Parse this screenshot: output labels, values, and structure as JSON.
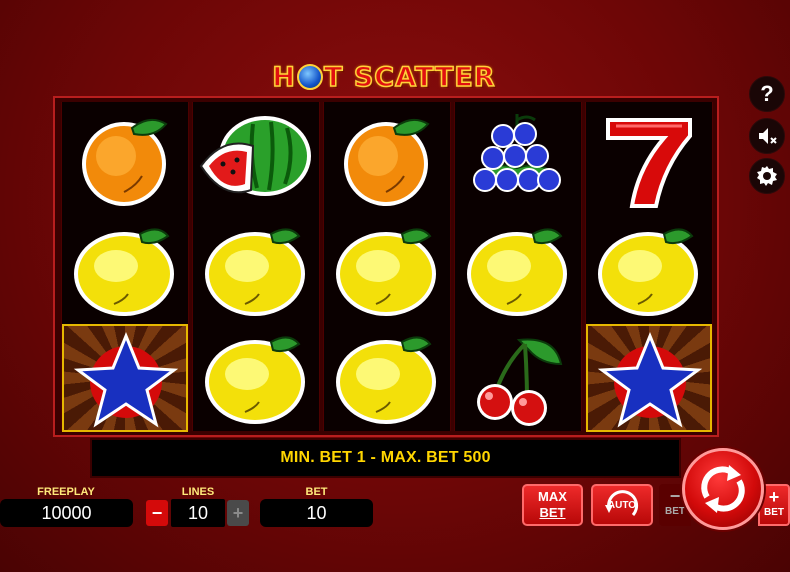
{
  "game": {
    "title_part1": "H",
    "title_part2": "T SCATTER"
  },
  "reels": [
    [
      "orange-icon",
      "lemon-icon",
      "star-scatter-icon"
    ],
    [
      "watermelon-icon",
      "lemon-icon",
      "lemon-icon"
    ],
    [
      "orange-icon",
      "lemon-icon",
      "lemon-icon"
    ],
    [
      "grapes-icon",
      "lemon-icon",
      "cherries-icon"
    ],
    [
      "seven-icon",
      "lemon-icon",
      "star-scatter-icon"
    ]
  ],
  "info_bar": {
    "text": "MIN. BET 1 - MAX. BET 500"
  },
  "side_menu": {
    "help_icon": "question-icon",
    "sound_icon": "sound-muted-icon",
    "settings_icon": "gear-icon",
    "help_label": "?"
  },
  "footer": {
    "freeplay_label": "FREEPLAY",
    "freeplay_value": "10000",
    "lines_label": "LINES",
    "lines_value": "10",
    "lines_minus": "−",
    "lines_plus": "+",
    "bet_label": "BET",
    "bet_value": "10",
    "max_bet_line1": "MAX",
    "max_bet_line2": "BET",
    "auto_label": "AUTO",
    "bet_minus_label": "BET",
    "bet_plus_label": "BET",
    "minus_symbol": "−",
    "plus_symbol": "+"
  },
  "colors": {
    "background": "#6d0606",
    "info_text": "#ffd600",
    "label_text": "#ffe97a",
    "button_red": "#d20a0a",
    "scatter_border": "#e6b800"
  }
}
